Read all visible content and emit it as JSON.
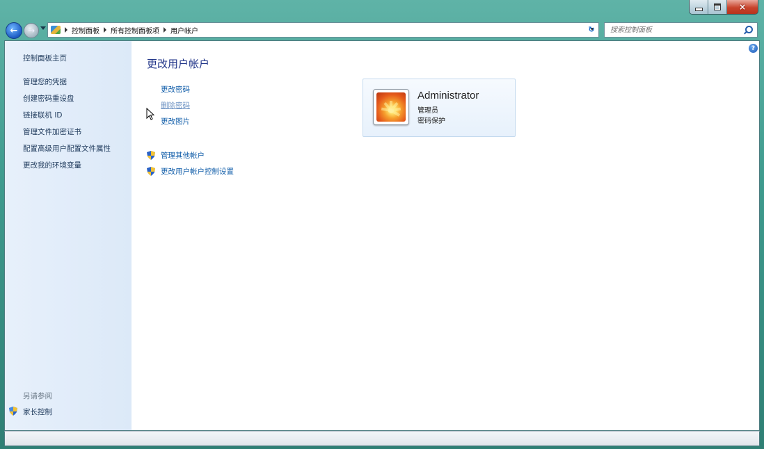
{
  "window": {
    "controls": {
      "minimize": "minimize-icon",
      "maximize": "maximize-icon",
      "close": "×"
    }
  },
  "nav": {
    "back_icon": "back-arrow-icon",
    "forward_icon": "forward-arrow-icon",
    "breadcrumbs": [
      "控制面板",
      "所有控制面板项",
      "用户帐户"
    ],
    "refresh_glyph": "↻",
    "search_placeholder": "搜索控制面板"
  },
  "sidebar": {
    "items": [
      "控制面板主页",
      "管理您的凭据",
      "创建密码重设盘",
      "链接联机 ID",
      "管理文件加密证书",
      "配置高级用户配置文件属性",
      "更改我的环境变量"
    ],
    "see_also": "另请参阅",
    "see_also_items": [
      "家长控制"
    ]
  },
  "main": {
    "heading": "更改用户帐户",
    "actions": [
      "更改密码",
      "删除密码",
      "更改图片"
    ],
    "shield_actions": [
      "管理其他帐户",
      "更改用户帐户控制设置"
    ],
    "help_glyph": "?"
  },
  "user": {
    "name": "Administrator",
    "role": "管理员",
    "status": "密码保护"
  },
  "colors": {
    "link": "#0d5ba8",
    "heading": "#1e3287",
    "sidebar_bg": "#e3eefa",
    "frame": "#3f9b8e"
  }
}
